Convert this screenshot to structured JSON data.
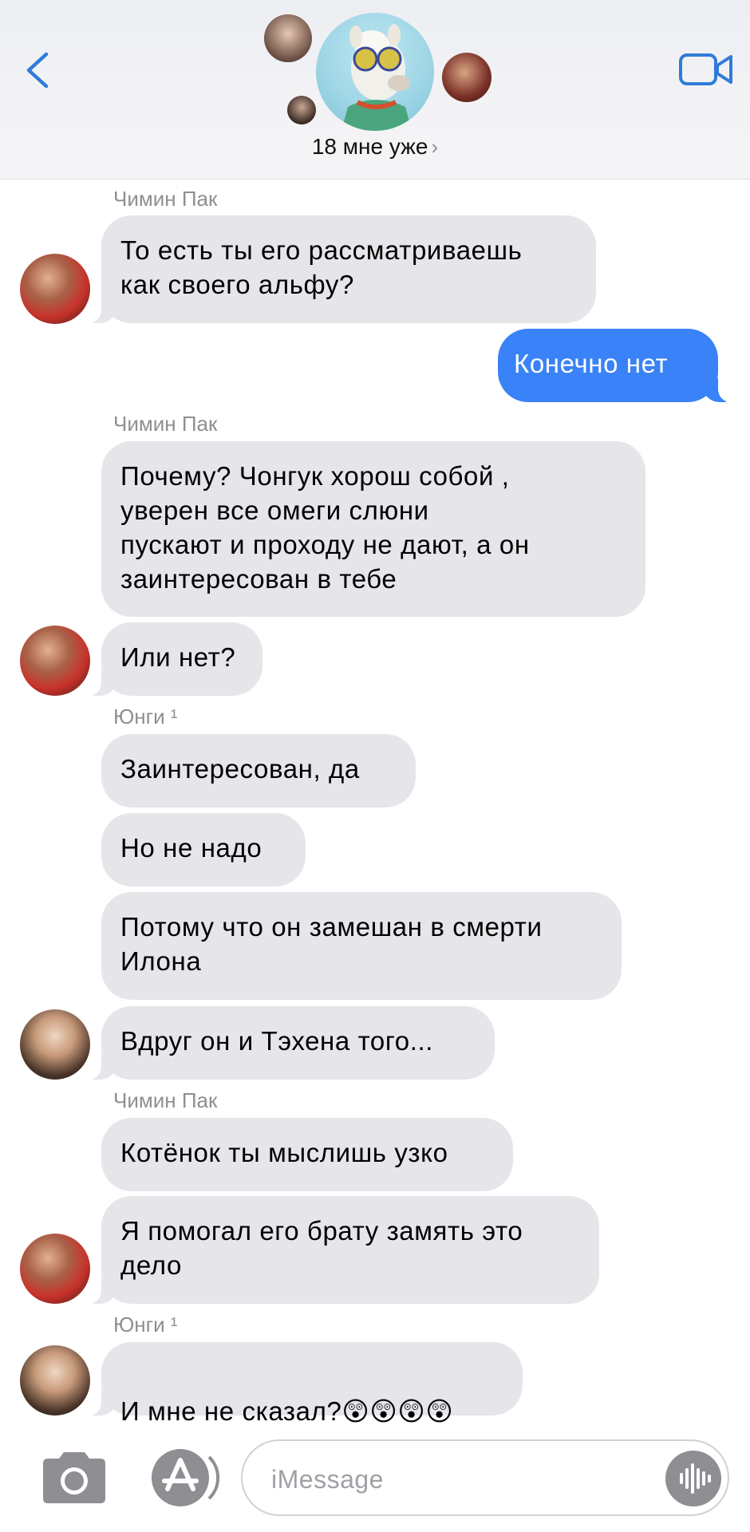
{
  "header": {
    "chat_title": "18 мне уже",
    "chevron": "›",
    "colors": {
      "accent": "#2f7bd8"
    }
  },
  "messages": {
    "m1_sender": "Чимин Пак",
    "m1_text": "То есть ты его рассматриваешь\nкак своего альфу?",
    "m2_text": "Конечно нет",
    "m3_sender": "Чимин Пак",
    "m3_text": "Почему? Чонгук хорош собой ,\nуверен все омеги слюни\nпускают и проходу не дают,  а он\nзаинтересован в тебе",
    "m4_text": "Или нет?",
    "m5_sender": "Юнги ¹",
    "m5_text": "Заинтересован,  да",
    "m6_text": "Но не надо",
    "m7_text": "Потому что он замешан в смерти\nИлона",
    "m8_text": "Вдруг он и Тэхена того...",
    "m9_sender": "Чимин Пак",
    "m9_text": "Котёнок ты мыслишь узко",
    "m10_text": "Я помогал его брату замять это\nдело",
    "m11_sender": "Юнги ¹",
    "m11_text": "И мне не сказал?",
    "m11_emoji": "😲😲😲😲"
  },
  "input": {
    "placeholder": "iMessage"
  },
  "icons": {
    "back": "chevron-left-icon",
    "video": "video-camera-icon",
    "camera": "camera-icon",
    "appstore": "app-store-icon",
    "audio": "audio-waveform-icon"
  },
  "colors": {
    "incoming_bubble": "#e5e5ea",
    "outgoing_bubble": "#3a82f7",
    "sender_name": "#8e8e93"
  }
}
